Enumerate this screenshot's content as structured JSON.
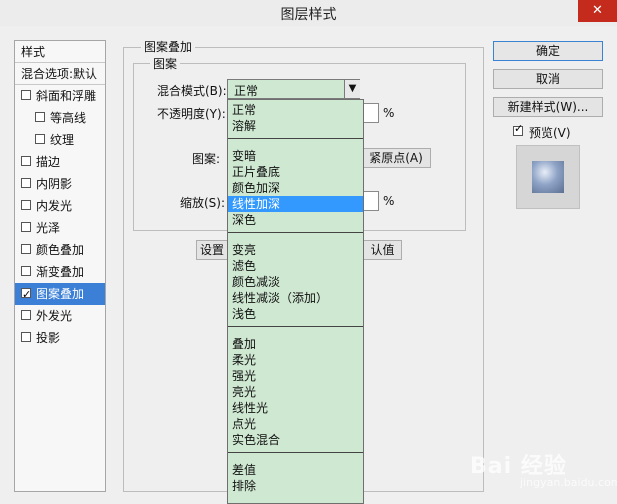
{
  "window": {
    "title": "图层样式",
    "close_icon": "close-icon"
  },
  "sidebar": {
    "header": "样式",
    "blend_options": "混合选项:默认",
    "items": [
      {
        "label": "斜面和浮雕",
        "checked": false,
        "indent": false
      },
      {
        "label": "等高线",
        "checked": false,
        "indent": true
      },
      {
        "label": "纹理",
        "checked": false,
        "indent": true
      },
      {
        "label": "描边",
        "checked": false,
        "indent": false
      },
      {
        "label": "内阴影",
        "checked": false,
        "indent": false
      },
      {
        "label": "内发光",
        "checked": false,
        "indent": false
      },
      {
        "label": "光泽",
        "checked": false,
        "indent": false
      },
      {
        "label": "颜色叠加",
        "checked": false,
        "indent": false
      },
      {
        "label": "渐变叠加",
        "checked": false,
        "indent": false
      },
      {
        "label": "图案叠加",
        "checked": true,
        "indent": false,
        "selected": true
      },
      {
        "label": "外发光",
        "checked": false,
        "indent": false
      },
      {
        "label": "投影",
        "checked": false,
        "indent": false
      }
    ]
  },
  "main": {
    "group_title": "图案叠加",
    "subgroup_title": "图案",
    "blend_mode_label": "混合模式(B):",
    "blend_mode_value": "正常",
    "opacity_label": "不透明度(Y):",
    "opacity_unit": "%",
    "pattern_label": "图案:",
    "snap_origin_label": "紧原点(A)",
    "scale_label": "缩放(S):",
    "scale_unit": "%",
    "set_default_label": "设置",
    "reset_default_label": "认值"
  },
  "dropdown": {
    "highlight_color": "#3399ff",
    "background_color": "#cfe8d2",
    "options": [
      [
        "正常",
        "溶解"
      ],
      [
        "变暗",
        "正片叠底",
        "颜色加深",
        "线性加深",
        "深色"
      ],
      [
        "变亮",
        "滤色",
        "颜色减淡",
        "线性减淡（添加）",
        "浅色"
      ],
      [
        "叠加",
        "柔光",
        "强光",
        "亮光",
        "线性光",
        "点光",
        "实色混合"
      ],
      [
        "差值",
        "排除"
      ]
    ],
    "highlighted": "线性加深"
  },
  "right_panel": {
    "ok_label": "确定",
    "cancel_label": "取消",
    "new_style_label": "新建样式(W)...",
    "preview_label": "预览(V)",
    "preview_checked": true
  },
  "watermark": {
    "text": "Bai 经验",
    "sub": "jingyan.baidu.com"
  }
}
